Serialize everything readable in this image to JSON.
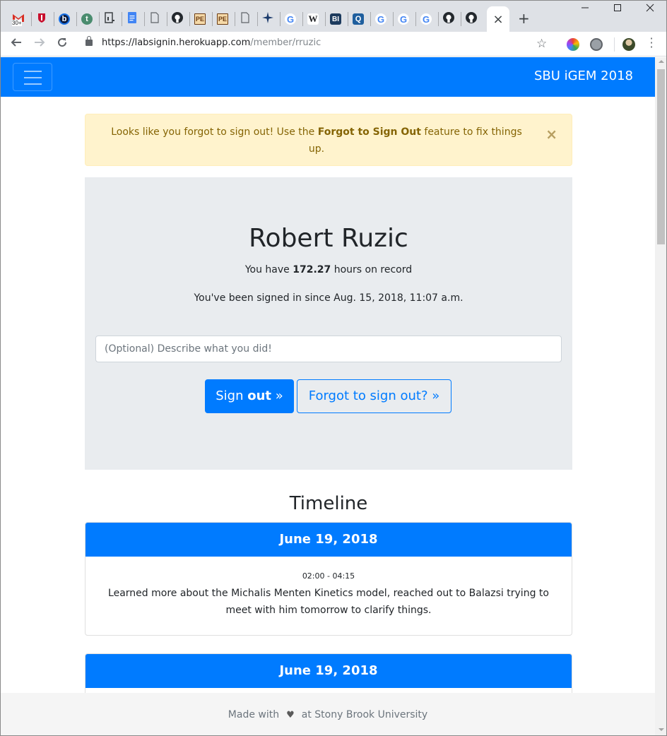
{
  "browser": {
    "tabs": [
      {
        "icon": "gmail-icon",
        "badge": "30+"
      },
      {
        "icon": "shield-icon"
      },
      {
        "icon": "b-circle-icon",
        "glyph": "b"
      },
      {
        "icon": "t-circle-icon",
        "glyph": "t"
      },
      {
        "icon": "doc-chart-icon"
      },
      {
        "icon": "google-docs-icon"
      },
      {
        "icon": "blank-page-icon"
      },
      {
        "icon": "github-icon"
      },
      {
        "icon": "pe-icon",
        "glyph": "PE"
      },
      {
        "icon": "pe-icon",
        "glyph": "PE"
      },
      {
        "icon": "blank-page-icon"
      },
      {
        "icon": "sparkle-icon"
      },
      {
        "icon": "google-icon",
        "glyph": "G"
      },
      {
        "icon": "wikipedia-icon",
        "glyph": "W"
      },
      {
        "icon": "bi-icon",
        "glyph": "BI"
      },
      {
        "icon": "q-icon",
        "glyph": "Q"
      },
      {
        "icon": "google-icon",
        "glyph": "G"
      },
      {
        "icon": "google-icon",
        "glyph": "G"
      },
      {
        "icon": "google-icon",
        "glyph": "G"
      },
      {
        "icon": "github-icon"
      },
      {
        "icon": "github-icon"
      }
    ],
    "close_tab": "×",
    "new_tab": "+",
    "url_host": "https://labsignin.herokuapp.com",
    "url_path": "/member/rruzic"
  },
  "navbar": {
    "brand": "SBU iGEM 2018"
  },
  "alert": {
    "text_before": "Looks like you forgot to sign out! Use the ",
    "text_bold": "Forgot to Sign Out",
    "text_after": " feature to fix things up.",
    "close": "×"
  },
  "member": {
    "name": "Robert Ruzic",
    "hours_prefix": "You have ",
    "hours": "172.27",
    "hours_suffix": " hours on record",
    "signed_in_since": "You've been signed in since Aug. 15, 2018, 11:07 a.m."
  },
  "form": {
    "description_placeholder": "(Optional) Describe what you did!",
    "signout_prefix": "Sign ",
    "signout_bold": "out",
    "signout_suffix": " »",
    "forgot_label": "Forgot to sign out? »"
  },
  "timeline": {
    "heading": "Timeline",
    "entries": [
      {
        "date": "June 19, 2018",
        "time": "02:00 - 04:15",
        "text": "Learned more about the Michalis Menten Kinetics model, reached out to Balazsi trying to meet with him tomorrow to clarify things."
      },
      {
        "date": "June 19, 2018"
      }
    ]
  },
  "footer": {
    "prefix": "Made with",
    "heart": "♥",
    "suffix": "at Stony Brook University"
  },
  "colors": {
    "primary": "#007bff",
    "alert_bg": "#fff3cd",
    "alert_text": "#856404",
    "jumbotron_bg": "#e9ecef"
  }
}
